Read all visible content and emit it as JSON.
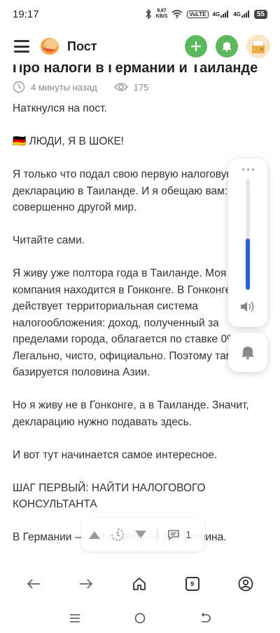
{
  "status_bar": {
    "time": "19:17",
    "net_speed_value": "9,67",
    "net_speed_unit": "KB/S",
    "volte": "VoLTE",
    "signal1": "4G",
    "signal2": "4G",
    "battery": "55"
  },
  "header": {
    "title": "Пост",
    "add_icon": "plus-icon",
    "notify_icon": "bell-icon"
  },
  "article": {
    "title": "Про налоги в Германии и Таиланде",
    "time_ago": "4 минуты назад",
    "views": "175",
    "paragraphs": [
      "Наткнулся на пост.",
      "🇩🇪 ЛЮДИ, Я В ШОКЕ!",
      "Я только что подал свою первую налоговую декларацию в Таиланде. И я обещаю вам: это совершенно другой мир.",
      "Читайте сами.",
      "Я живу уже полтора года в Таиланде. Моя компания находится в Гонконге. В Гонконге действует территориальная система налогообложения: доход, полученный за пределами города, облагается по ставке 0%. Легально, чисто, официально. Поэтому там базируется половина Азии.",
      "Но я живу не в Гонконге, а в Таиланде. Значит, декларацию нужно подавать здесь.",
      "И вот тут начинается самое интересное.",
      "ШАГ ПЕРВЫЙ: НАЙТИ НАЛОГОВОГО КОНСУЛЬТАНТА",
      "В Германии — это отдельная дисциплина."
    ]
  },
  "volume": {
    "level_percent": 46
  },
  "float_toolbar": {
    "comments_count": "1"
  },
  "browser_bar": {
    "tabs_count": "9"
  },
  "colors": {
    "accent_green": "#5cb85c",
    "volume_blue": "#2a62d8"
  }
}
